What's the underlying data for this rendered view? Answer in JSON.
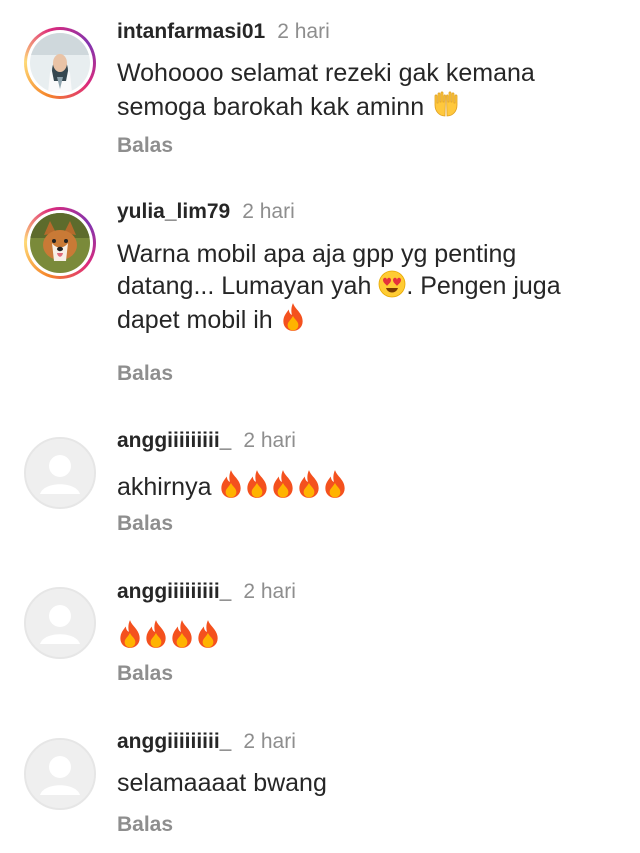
{
  "comments": [
    {
      "username": "intanfarmasi01",
      "time": "2 hari",
      "text": "Wohoooo selamat rezeki gak kemana semoga barokah kak aminn",
      "reply": "Balas"
    },
    {
      "username": "yulia_lim79",
      "time": "2 hari",
      "text_1": "Warna mobil apa aja gpp yg penting datang... Lumayan yah",
      "text_2": ". Pengen juga dapet mobil ih",
      "reply": "Balas"
    },
    {
      "username": "anggiiiiiiiii_",
      "time": "2 hari",
      "text": "akhirnya",
      "reply": "Balas"
    },
    {
      "username": "anggiiiiiiiii_",
      "time": "2 hari",
      "text": "",
      "reply": "Balas"
    },
    {
      "username": "anggiiiiiiiii_",
      "time": "2 hari",
      "text": "selamaaaat bwang",
      "reply": "Balas"
    }
  ],
  "icons": {
    "prayer": "hands-icon",
    "love": "heart-eyes-emoji",
    "fire": "fire-emoji"
  },
  "colors": {
    "text": "#262626",
    "muted": "#8e8e8e",
    "story_ring": "#dd2a7b"
  }
}
